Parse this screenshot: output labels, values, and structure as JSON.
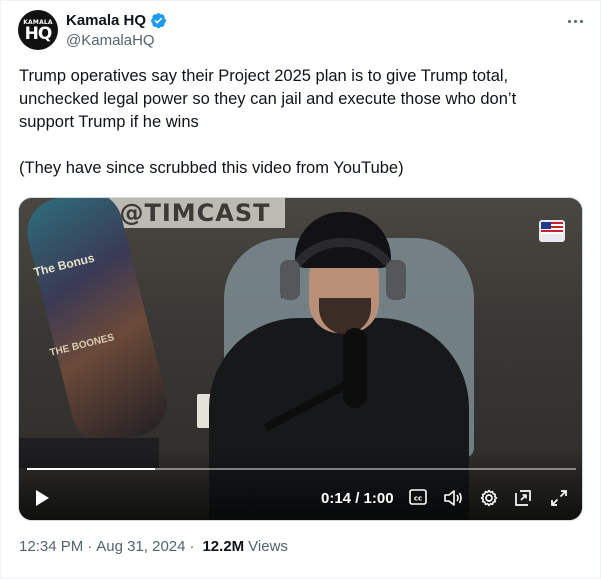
{
  "author": {
    "avatar_text_top": "KAMALA",
    "avatar_text_main": "HQ",
    "display_name": "Kamala HQ",
    "handle": "@KamalaHQ",
    "verified": true,
    "verified_color": "#1d9bf0"
  },
  "tweet": {
    "text_lines": [
      "Trump operatives say their Project 2025 plan is to give Trump total,",
      "unchecked legal power so they can jail and execute those who don’t",
      "support Trump if he wins"
    ],
    "text_after": "(They have since scrubbed this video from YouTube)"
  },
  "video": {
    "overlay_sign": "@TIMCAST",
    "board_text_1": "The Bonus",
    "board_text_2": "THE BOONES",
    "current_time": "0:14",
    "duration": "1:00",
    "time_display": "0:14 / 1:00",
    "progress_fraction": 0.233,
    "icons": {
      "play": "play-icon",
      "captions": "closed-captions-icon",
      "volume": "volume-icon",
      "settings": "gear-icon",
      "pip": "picture-in-picture-icon",
      "fullscreen": "fullscreen-icon"
    }
  },
  "footer": {
    "time": "12:34 PM",
    "separator": "·",
    "date": "Aug 31, 2024",
    "views_count": "12.2M",
    "views_label": "Views"
  },
  "colors": {
    "text_primary": "#0f1419",
    "text_secondary": "#536471",
    "border": "#cfd9de"
  }
}
